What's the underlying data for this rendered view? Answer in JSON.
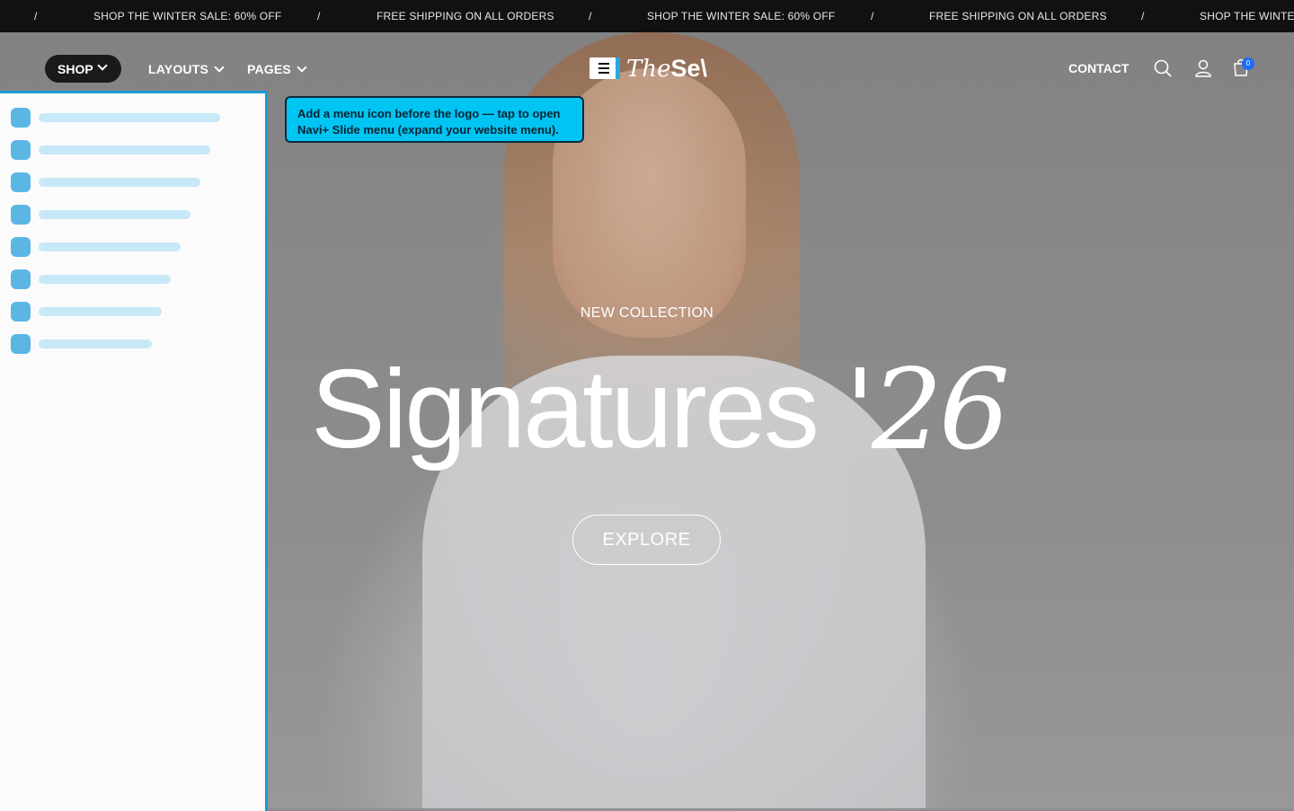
{
  "announcement": {
    "separator": "/",
    "items": [
      "SHOP THE WINTER SALE: 60% OFF",
      "FREE SHIPPING ON ALL ORDERS",
      "SHOP THE WINTER SALE: 60% OFF",
      "FREE SHIPPING ON ALL ORDERS",
      "SHOP THE WINTER"
    ]
  },
  "header": {
    "nav": [
      {
        "label": "SHOP"
      },
      {
        "label": "LAYOUTS"
      },
      {
        "label": "PAGES"
      }
    ],
    "logo": {
      "part1": "The",
      "part2": "Se\\"
    },
    "contact": "CONTACT",
    "cart_count": "0",
    "icons": [
      "hamburger-icon",
      "search-icon",
      "user-icon",
      "cart-icon",
      "chevron-down-icon"
    ]
  },
  "tooltip": {
    "text": "Add a menu icon before the logo — tap to open Navi+ Slide menu (expand your website menu)."
  },
  "hero": {
    "eyebrow": "NEW COLLECTION",
    "headline": "Signatures",
    "year": "'26",
    "cta": "EXPLORE"
  },
  "colors": {
    "accent": "#1d9ad6",
    "tooltip_bg": "#00c4f2",
    "badge": "#1e6ef5",
    "announcement_bg": "#111111"
  }
}
